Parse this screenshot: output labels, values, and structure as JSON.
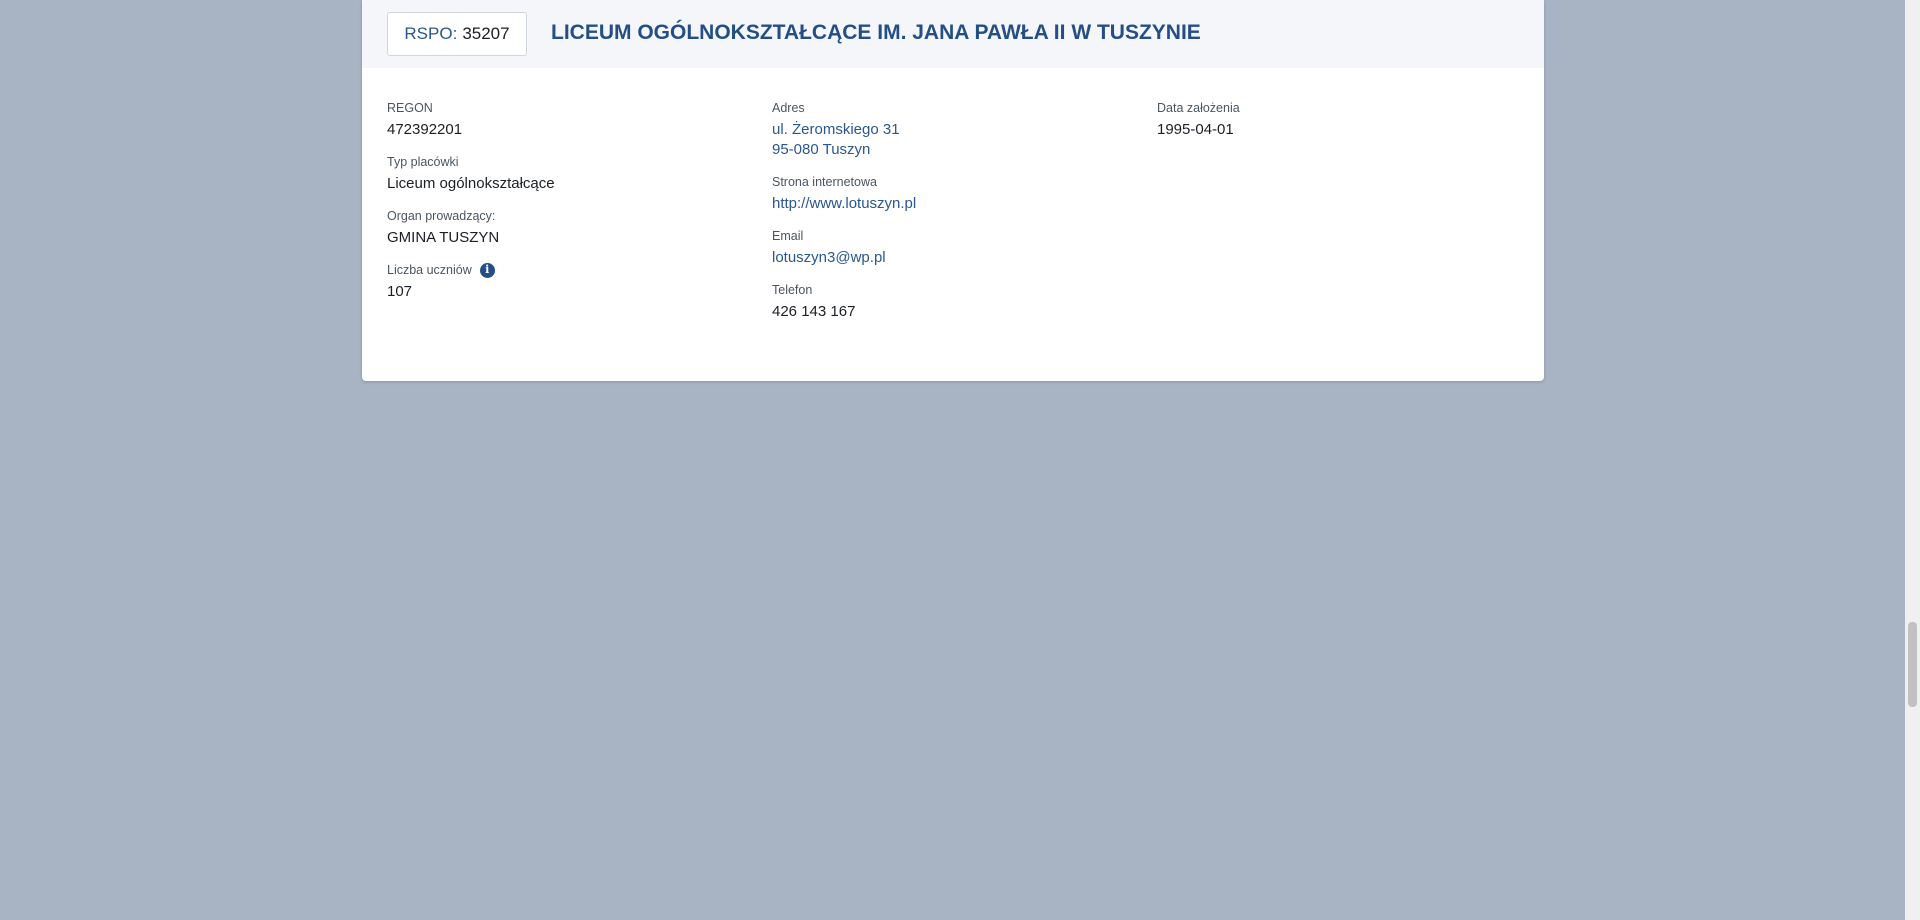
{
  "header": {
    "rspo_label": "RSPO:",
    "rspo_value": "35207",
    "title": "LICEUM OGÓLNOKSZTAŁCĄCE IM. JANA PAWŁA II W TUSZYNIE"
  },
  "column1": {
    "regon": {
      "label": "REGON",
      "value": "472392201"
    },
    "type": {
      "label": "Typ placówki",
      "value": "Liceum ogólnokształcące"
    },
    "organ": {
      "label": "Organ prowadzący:",
      "value": "GMINA TUSZYN"
    },
    "students": {
      "label": "Liczba uczniów",
      "value": "107",
      "icon": "info-icon"
    }
  },
  "column2": {
    "address": {
      "label": "Adres",
      "line1": "ul. Żeromskiego 31",
      "line2": "95-080 Tuszyn"
    },
    "website": {
      "label": "Strona internetowa",
      "value": "http://www.lotuszyn.pl"
    },
    "email": {
      "label": "Email",
      "value": "lotuszyn3@wp.pl"
    },
    "phone": {
      "label": "Telefon",
      "value": "426 143 167"
    }
  },
  "column3": {
    "founded": {
      "label": "Data założenia",
      "value": "1995-04-01"
    }
  },
  "colors": {
    "background": "#a8b4c3",
    "accent": "#244f86",
    "link": "#2a5691"
  }
}
